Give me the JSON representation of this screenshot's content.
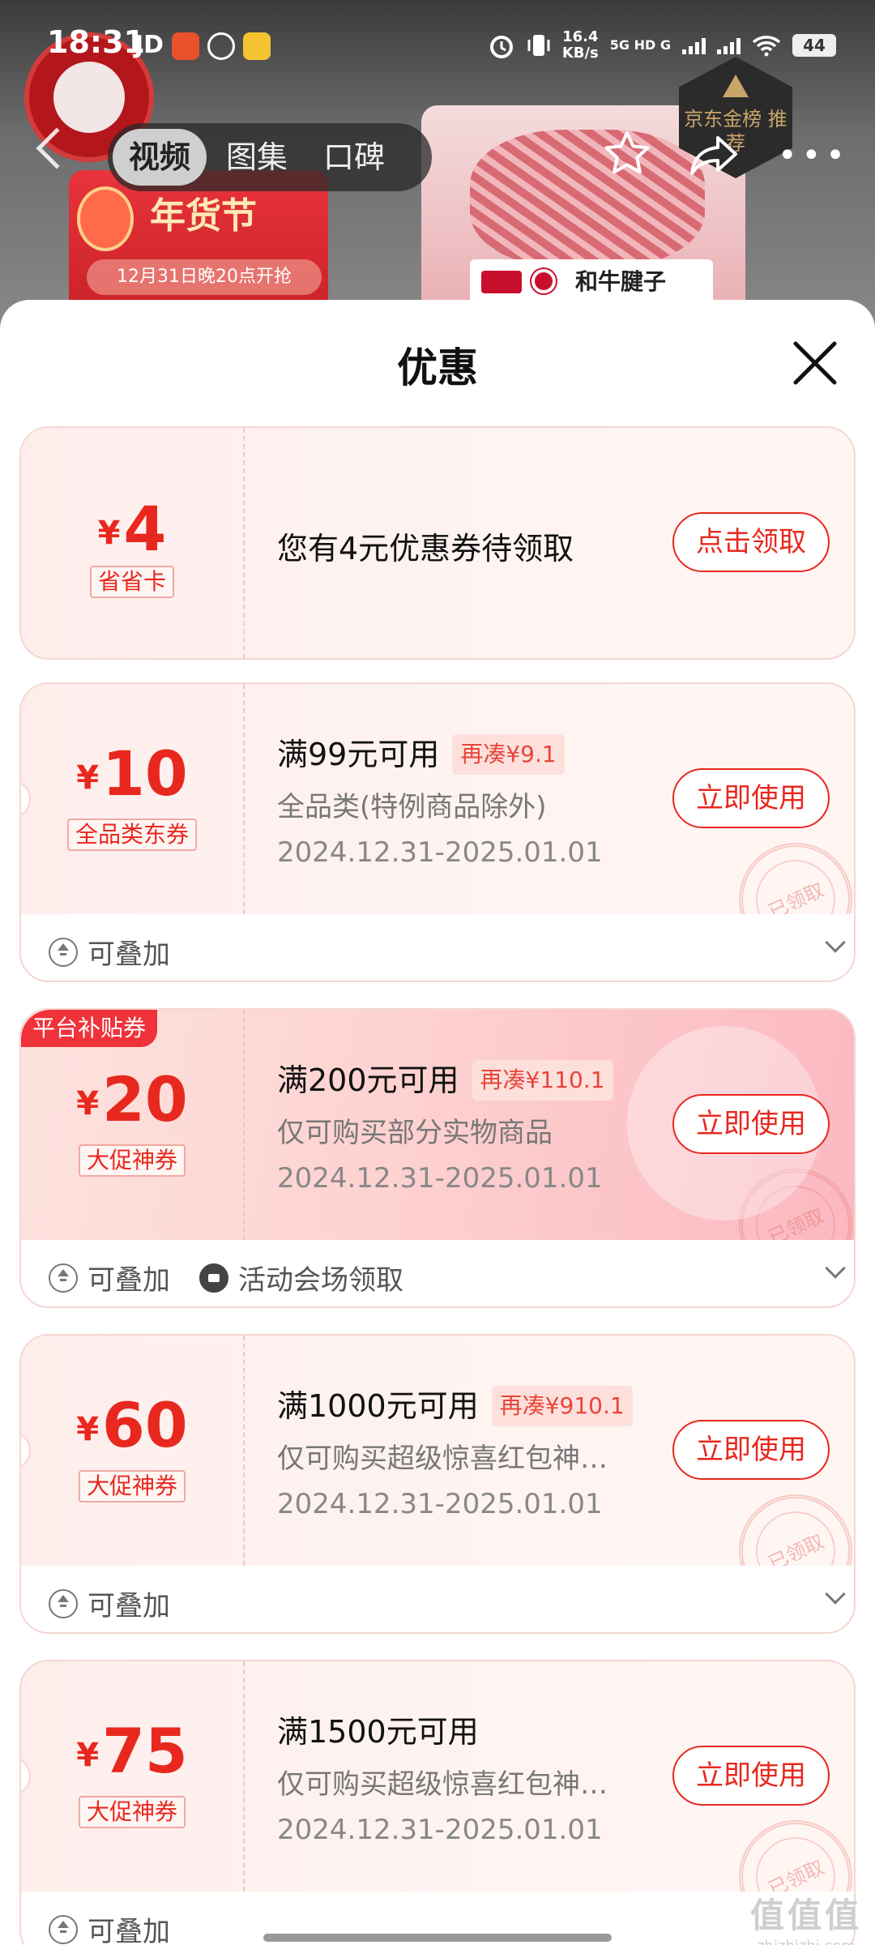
{
  "status_bar": {
    "time": "18:31",
    "carrier": "JD",
    "speed_value": "16.4",
    "speed_unit": "KB/s",
    "network": "5G HD G",
    "battery": "44"
  },
  "backdrop": {
    "promo_title": "年货节",
    "promo_subtitle": "12月31日晚20点开抢",
    "product_label": "和牛腱子",
    "rank_badge": "京东金榜 推荐"
  },
  "media_tabs": [
    {
      "label": "视频",
      "active": true
    },
    {
      "label": "图集",
      "active": false
    },
    {
      "label": "口碑",
      "active": false
    }
  ],
  "sheet": {
    "title": "优惠"
  },
  "coupons": [
    {
      "currency": "¥",
      "amount": "4",
      "tag": "省省卡",
      "headline": "您有4元优惠券待领取",
      "action": "点击领取"
    },
    {
      "currency": "¥",
      "amount": "10",
      "tag": "全品类东券",
      "condition": "满99元可用",
      "gap": "再凑¥9.1",
      "description": "全品类(特例商品除外)",
      "date": "2024.12.31-2025.01.01",
      "action": "立即使用",
      "stamp": "已领取",
      "footer": [
        "可叠加"
      ]
    },
    {
      "ribbon": "平台补贴券",
      "currency": "¥",
      "amount": "20",
      "tag": "大促神券",
      "condition": "满200元可用",
      "gap": "再凑¥110.1",
      "description": "仅可购买部分实物商品",
      "date": "2024.12.31-2025.01.01",
      "action": "立即使用",
      "stamp": "已领取",
      "footer": [
        "可叠加",
        "活动会场领取"
      ]
    },
    {
      "currency": "¥",
      "amount": "60",
      "tag": "大促神券",
      "condition": "满1000元可用",
      "gap": "再凑¥910.1",
      "description": "仅可购买超级惊喜红包神…",
      "date": "2024.12.31-2025.01.01",
      "action": "立即使用",
      "stamp": "已领取",
      "footer": [
        "可叠加"
      ]
    },
    {
      "currency": "¥",
      "amount": "75",
      "tag": "大促神券",
      "condition": "满1500元可用",
      "description": "仅可购买超级惊喜红包神…",
      "date": "2024.12.31-2025.01.01",
      "action": "立即使用",
      "stamp": "已领取",
      "footer": [
        "可叠加"
      ]
    }
  ],
  "watermark": {
    "logo": "值值值",
    "url": "zhizhizhi.com"
  },
  "colors": {
    "accent": "#e8281e",
    "ribbon": "#f0323a",
    "coupon_border": "#f5d6d2"
  }
}
